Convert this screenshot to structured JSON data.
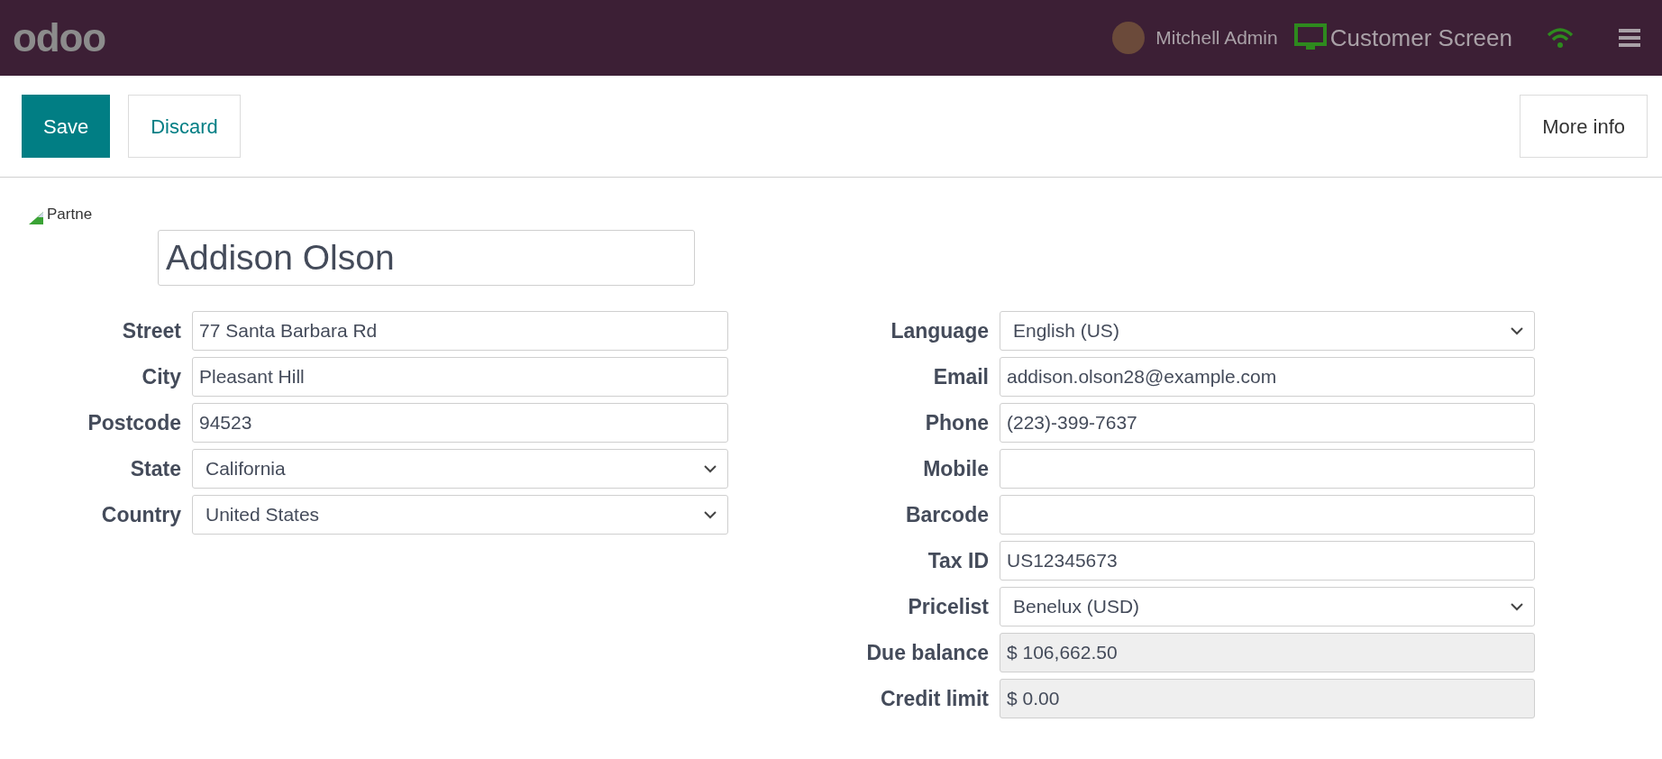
{
  "header": {
    "logo": "odoo",
    "user": "Mitchell Admin",
    "customer_screen": "Customer Screen"
  },
  "actions": {
    "save": "Save",
    "discard": "Discard",
    "more_info": "More info"
  },
  "partner_image": {
    "alt": "Partne"
  },
  "name": "Addison Olson",
  "left_fields": [
    {
      "label": "Street",
      "kind": "text",
      "value": "77 Santa Barbara Rd"
    },
    {
      "label": "City",
      "kind": "text",
      "value": "Pleasant Hill"
    },
    {
      "label": "Postcode",
      "kind": "text",
      "value": "94523"
    },
    {
      "label": "State",
      "kind": "select",
      "value": "California"
    },
    {
      "label": "Country",
      "kind": "select",
      "value": "United States"
    }
  ],
  "right_fields": [
    {
      "label": "Language",
      "kind": "select",
      "value": "English (US)"
    },
    {
      "label": "Email",
      "kind": "text",
      "value": "addison.olson28@example.com"
    },
    {
      "label": "Phone",
      "kind": "text",
      "value": "(223)-399-7637"
    },
    {
      "label": "Mobile",
      "kind": "text"
    },
    {
      "label": "Barcode",
      "kind": "text"
    },
    {
      "label": "Tax ID",
      "kind": "text",
      "value": "US12345673"
    },
    {
      "label": "Pricelist",
      "kind": "select",
      "value": "Benelux (USD)"
    },
    {
      "label": "Due balance",
      "kind": "readonly",
      "value": "$ 106,662.50"
    },
    {
      "label": "Credit limit",
      "kind": "readonly",
      "value": "$ 0.00"
    }
  ]
}
